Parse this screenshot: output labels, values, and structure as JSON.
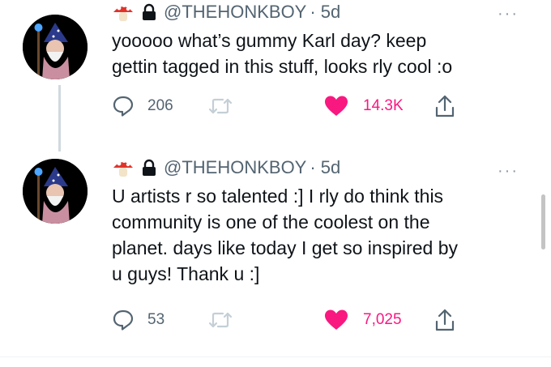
{
  "tweets": [
    {
      "handle": "@THEHONKBOY",
      "time": "· 5d",
      "text": "yooooo what’s gummy Karl day? keep\ngettin tagged in this stuff, looks rly cool :o",
      "reply_count": "206",
      "retweet_count": "",
      "like_count": "14.3K"
    },
    {
      "handle": "@THEHONKBOY",
      "time": "· 5d",
      "text": "U artists r so talented :] I rly do think this\ncommunity is one of the coolest on the\nplanet. days like today I get so inspired by\nu guys! Thank u :]",
      "reply_count": "53",
      "retweet_count": "",
      "like_count": "7,025"
    }
  ],
  "more_symbol": "···",
  "colors": {
    "like": "#f91880",
    "muted": "#536471",
    "text": "#0f1419",
    "thread_line": "#cfd9de"
  },
  "icons": {
    "emoji": "mushroom-icon",
    "locked": "lock-icon",
    "reply": "reply-icon",
    "retweet": "retweet-icon",
    "like": "heart-icon",
    "share": "share-icon"
  }
}
